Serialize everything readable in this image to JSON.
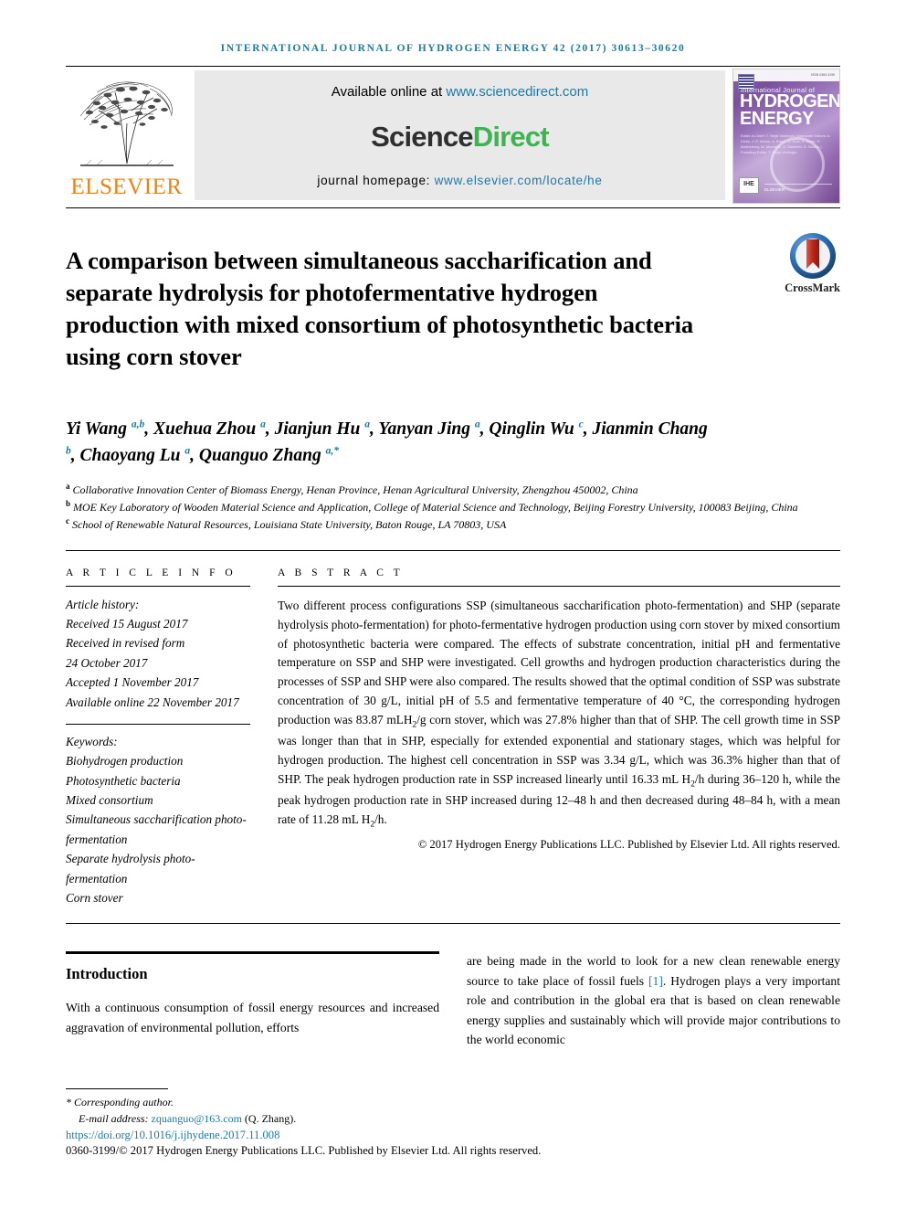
{
  "running_head": "INTERNATIONAL JOURNAL OF HYDROGEN ENERGY 42 (2017) 30613–30620",
  "masthead": {
    "publisher_name": "ELSEVIER",
    "available_label": "Available online at",
    "available_url": "www.sciencedirect.com",
    "sciencedirect_part1": "Science",
    "sciencedirect_part2": "Direct",
    "homepage_label": "journal homepage:",
    "homepage_url": "www.elsevier.com/locate/he",
    "cover": {
      "journal_small": "International Journal of",
      "title_line1": "HYDROGEN",
      "title_line2": "ENERGY",
      "issn_text": "ISSN 0360-3199",
      "elsevier_footer": "ELSEVIER",
      "editor_block": "Editor-in-Chief: T. Nejat Veziroglu  |  Associate Editors: A. Dicks, J.-P. Abbou, A. Ersoz, N. Duic, S. Dunn, H. Barthelemy, M. Momirlan, A. Steinfeld, D. Stolten  |  Founding Editor: T. Nejat Veziroglu"
    }
  },
  "crossmark": {
    "label": "CrossMark"
  },
  "title": "A comparison between simultaneous saccharification and separate hydrolysis for photofermentative hydrogen production with mixed consortium of photosynthetic bacteria using corn stover",
  "authors_html": "Yi Wang <sup>a,b</sup>, Xuehua Zhou <sup>a</sup>, Jianjun Hu <sup>a</sup>, Yanyan Jing <sup>a</sup>, Qinglin Wu <sup>c</sup>, Jianmin Chang <sup>b</sup>, Chaoyang Lu <sup>a</sup>, Quanguo Zhang <sup>a,*</sup>",
  "affiliations": [
    {
      "marker": "a",
      "text": "Collaborative Innovation Center of Biomass Energy, Henan Province, Henan Agricultural University, Zhengzhou 450002, China"
    },
    {
      "marker": "b",
      "text": "MOE Key Laboratory of Wooden Material Science and Application, College of Material Science and Technology, Beijing Forestry University, 100083 Beijing, China"
    },
    {
      "marker": "c",
      "text": "School of Renewable Natural Resources, Louisiana State University, Baton Rouge, LA 70803, USA"
    }
  ],
  "article_info": {
    "heading": "A R T I C L E   I N F O",
    "history_label": "Article history:",
    "history": [
      "Received 15 August 2017",
      "Received in revised form",
      "24 October 2017",
      "Accepted 1 November 2017",
      "Available online 22 November 2017"
    ],
    "keywords_label": "Keywords:",
    "keywords": [
      "Biohydrogen production",
      "Photosynthetic bacteria",
      "Mixed consortium",
      "Simultaneous saccharification photo-fermentation",
      "Separate hydrolysis photo-fermentation",
      "Corn stover"
    ]
  },
  "abstract": {
    "heading": "A B S T R A C T",
    "body_html": "Two different process configurations SSP (simultaneous saccharification photo-fermentation) and SHP (separate hydrolysis photo-fermentation) for photo-fermentative hydrogen production using corn stover by mixed consortium of photosynthetic bacteria were compared. The effects of substrate concentration, initial pH and fermentative temperature on SSP and SHP were investigated. Cell growths and hydrogen production characteristics during the processes of SSP and SHP were also compared. The results showed that the optimal condition of SSP was substrate concentration of 30 g/L, initial pH of 5.5 and fermentative temperature of 40 &#176;C, the corresponding hydrogen production was 83.87 mLH<sub>2</sub>/g corn stover, which was 27.8% higher than that of SHP. The cell growth time in SSP was longer than that in SHP, especially for extended exponential and stationary stages, which was helpful for hydrogen production. The highest cell concentration in SSP was 3.34 g/L, which was 36.3% higher than that of SHP. The peak hydrogen production rate in SSP increased linearly until 16.33 mL H<sub>2</sub>/h during 36&#8211;120 h, while the peak hydrogen production rate in SHP increased during 12&#8211;48 h and then decreased during 48&#8211;84 h, with a mean rate of 11.28 mL H<sub>2</sub>/h.",
    "copyright": "© 2017 Hydrogen Energy Publications LLC. Published by Elsevier Ltd. All rights reserved."
  },
  "introduction": {
    "heading": "Introduction",
    "left_text": "With a continuous consumption of fossil energy resources and increased aggravation of environmental pollution, efforts",
    "right_text_pre": "are being made in the world to look for a new clean renewable energy source to take place of fossil fuels ",
    "right_citation": "[1]",
    "right_text_post": ". Hydrogen plays a very important role and contribution in the global era that is based on clean renewable energy supplies and sustainably which will provide major contributions to the world economic"
  },
  "footnote": {
    "corresponding": "* Corresponding author.",
    "email_label": "E-mail address:",
    "email": "zquanguo@163.com",
    "email_suffix": "(Q. Zhang).",
    "doi": "https://doi.org/10.1016/j.ijhydene.2017.11.008",
    "issn_line": "0360-3199/© 2017 Hydrogen Energy Publications LLC. Published by Elsevier Ltd. All rights reserved."
  },
  "colors": {
    "link": "#1a7aa8",
    "elsevier_orange": "#f08010",
    "sciencedirect_green": "#3fb34f",
    "crossmark_blue": "#2a6ebb",
    "crossmark_red": "#c0392b"
  }
}
